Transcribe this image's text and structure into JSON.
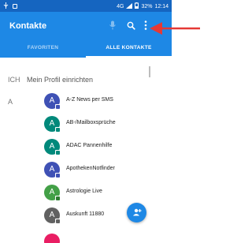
{
  "status_bar": {
    "network": "4G",
    "battery": "32%",
    "time": "12:14"
  },
  "toolbar": {
    "title": "Kontakte"
  },
  "tabs": [
    {
      "label": "FAVORITEN",
      "active": false
    },
    {
      "label": "ALLE KONTAKTE",
      "active": true
    }
  ],
  "sections": {
    "me": "ICH",
    "letter_a": "A"
  },
  "profile": {
    "label": "Mein Profil einrichten"
  },
  "contacts": [
    {
      "initial": "A",
      "name": "A-Z News per SMS",
      "color": "#3f51b5"
    },
    {
      "initial": "A",
      "name": "AB-/Mailboxsprüche",
      "color": "#00897b"
    },
    {
      "initial": "A",
      "name": "ADAC Pannenhilfe",
      "color": "#00897b"
    },
    {
      "initial": "A",
      "name": "ApothekenNotfinder",
      "color": "#3f51b5"
    },
    {
      "initial": "A",
      "name": "Astrologie Live",
      "color": "#43a047"
    },
    {
      "initial": "A",
      "name": "Auskunft 11880",
      "color": "#616161"
    }
  ],
  "colors": {
    "primary": "#1e88e5",
    "status_bar": "#1565c0",
    "annotation_arrow": "#e53935"
  },
  "icons": [
    "mic-icon",
    "search-icon",
    "more-vert-icon",
    "add-contact-icon"
  ]
}
